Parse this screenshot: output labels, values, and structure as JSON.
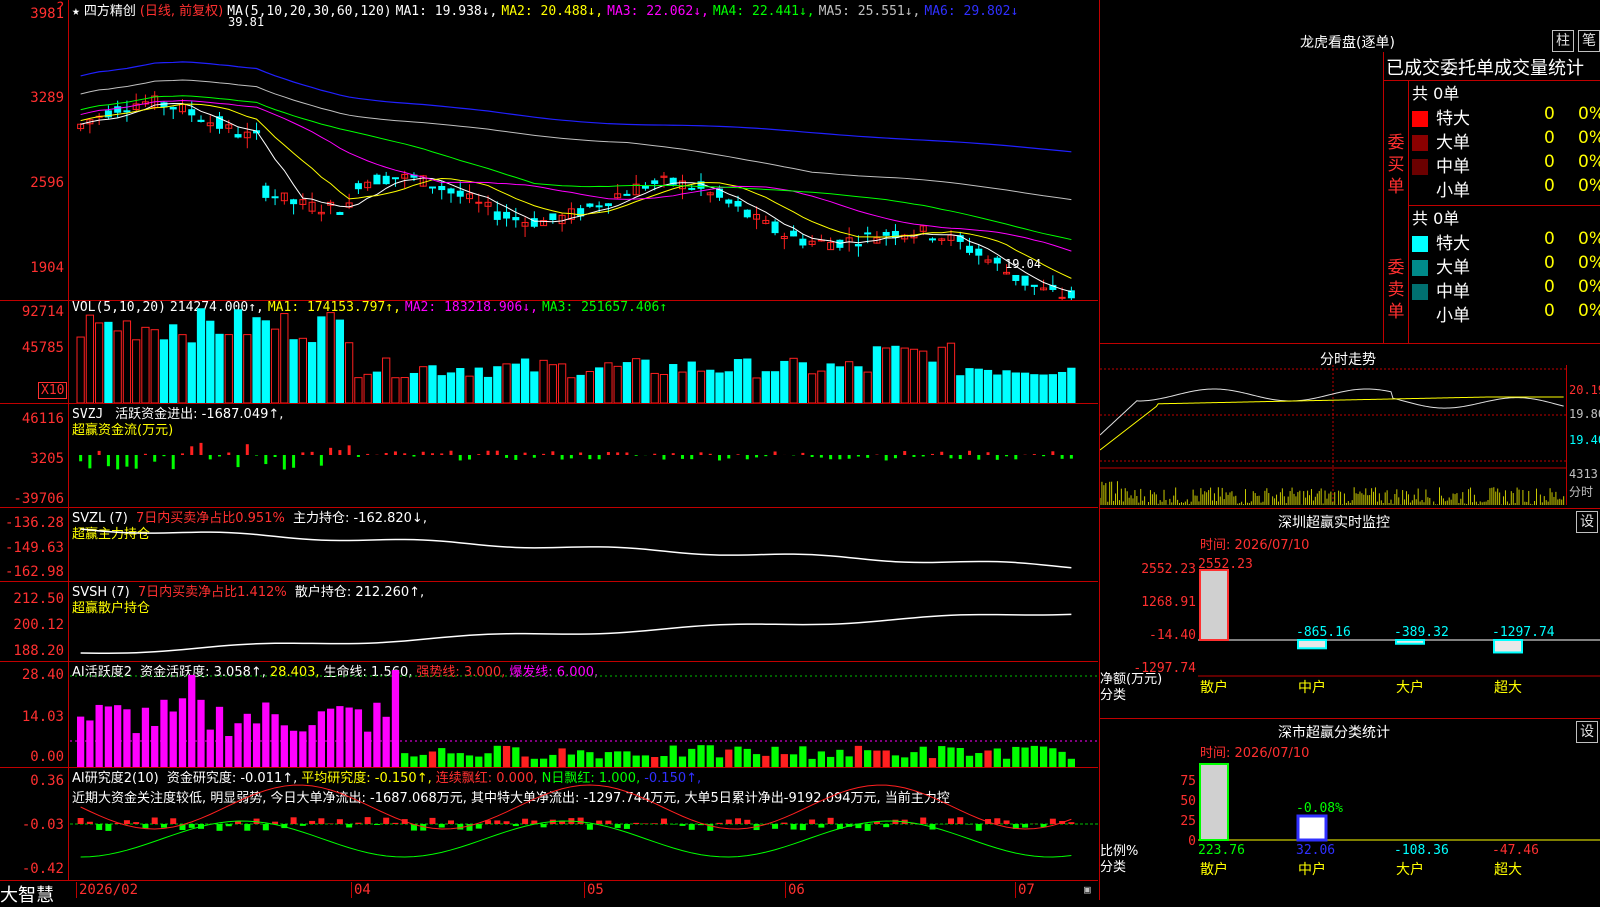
{
  "app": {
    "brand": "大智慧"
  },
  "main_chart": {
    "stock_name": "四方精创",
    "mode": "(日线, 前复权)",
    "ma_label": "MA(5,10,20,30,60,120)",
    "ma1": "MA1: 19.938↓,",
    "ma2": "MA2: 20.488↓,",
    "ma3": "MA3: 22.062↓,",
    "ma4": "MA4: 22.441↓,",
    "ma5": "MA5: 25.551↓,",
    "ma6": "MA6: 29.802↓",
    "y_ticks": [
      "3981",
      "3289",
      "2596",
      "1904"
    ],
    "high_label": "39.81",
    "low_label": "19.04"
  },
  "vol_pane": {
    "title": "VOL(5,10,20)",
    "vol": "214274.000↑,",
    "ma1": "MA1: 174153.797↑,",
    "ma2": "MA2: 183218.906↓,",
    "ma3": "MA3: 251657.406↑",
    "y_ticks": [
      "92714",
      "45785"
    ],
    "unit": "X10"
  },
  "svzj_pane": {
    "title": "SVZJ",
    "value": "活跃资金进出: -1687.049↑,",
    "subtitle": "超赢资金流(万元)",
    "y_ticks": [
      "46116",
      "3205",
      "-39706"
    ]
  },
  "svzl_pane": {
    "title": "SVZL (7)",
    "ratio": "7日内买卖净占比0.951%",
    "value": "主力持仓: -162.820↓,",
    "subtitle": "超赢主力持仓",
    "y_ticks": [
      "-136.28",
      "-149.63",
      "-162.98"
    ]
  },
  "svsh_pane": {
    "title": "SVSH (7)",
    "ratio": "7日内买卖净占比1.412%",
    "value": "散户持仓: 212.260↑,",
    "subtitle": "超赢散户持仓",
    "y_ticks": [
      "212.50",
      "200.12",
      "188.20"
    ]
  },
  "ai_active_pane": {
    "title": "AI活跃度2",
    "v1": "资金活跃度: 3.058↑,",
    "v2": "28.403,",
    "v3": "生命线: 1.560,",
    "v4": "强势线: 3.000,",
    "v5": "爆发线: 6.000,",
    "y_ticks": [
      "28.40",
      "14.03",
      "0.00"
    ]
  },
  "ai_research_pane": {
    "title": "AI研究度2(10)",
    "v1": "资金研究度: -0.011↑,",
    "v2": "平均研究度: -0.150↑,",
    "v3": "连续飘红: 0.000,",
    "v4": "N日飘红: 1.000,",
    "v5": "-0.150↑,",
    "commentary": "近期大资金关注度较低, 明显弱势, 今日大单净流出: -1687.068万元, 其中特大单净流出: -1297.744万元, 大单5日累计净出-9192.094万元, 当前主力控",
    "y_ticks": [
      "0.36",
      "-0.03",
      "-0.42"
    ]
  },
  "x_axis": [
    "2026/02",
    "04",
    "05",
    "06",
    "07"
  ],
  "dragon_tiger": {
    "title": "龙虎看盘(逐单)",
    "btn_bar": "柱",
    "btn_pen": "笔",
    "headline": "已成交委托单成交量统计",
    "buy_label": "委买单",
    "sell_label": "委卖单",
    "buy_total": "共 0单",
    "sell_total": "共 0单",
    "buy_rows": [
      {
        "label": "特大",
        "count": "0",
        "pct": "0%",
        "color": "#ff0000"
      },
      {
        "label": "大单",
        "count": "0",
        "pct": "0%",
        "color": "#8b0000"
      },
      {
        "label": "中单",
        "count": "0",
        "pct": "0%",
        "color": "#6b0000"
      },
      {
        "label": "小单",
        "count": "0",
        "pct": "0%",
        "color": "#000000"
      }
    ],
    "sell_rows": [
      {
        "label": "特大",
        "count": "0",
        "pct": "0%",
        "color": "#00ffff"
      },
      {
        "label": "大单",
        "count": "0",
        "pct": "0%",
        "color": "#008b8b"
      },
      {
        "label": "中单",
        "count": "0",
        "pct": "0%",
        "color": "#007070"
      },
      {
        "label": "小单",
        "count": "0",
        "pct": "0%",
        "color": "#000000"
      }
    ]
  },
  "intraday": {
    "title": "分时走势",
    "price_ticks": [
      "20.19",
      "19.80",
      "19.40"
    ],
    "vol_tick": "4313",
    "vol_label": "分时"
  },
  "sz_monitor": {
    "title": "深圳超赢实时监控",
    "btn": "设",
    "time_label": "时间: 2026/07/10",
    "y_ticks": [
      "2552.23",
      "1268.91",
      "-14.40",
      "-1297.74"
    ],
    "y_unit": "净额(万元)",
    "cat_label": "分类",
    "categories": [
      "散户",
      "中户",
      "大户",
      "超大"
    ],
    "values": [
      2552.23,
      -865.16,
      -389.32,
      -1297.74
    ],
    "value_labels": [
      "2552.23",
      "-865.16",
      "-389.32",
      "-1297.74"
    ]
  },
  "sz_class": {
    "title": "深市超赢分类统计",
    "btn": "设",
    "time_label": "时间: 2026/07/10",
    "y_ticks": [
      "75",
      "50",
      "25",
      "0"
    ],
    "y_unit": "比例%",
    "cat_label": "分类",
    "categories": [
      "散户",
      "中户",
      "大户",
      "超大"
    ],
    "values": [
      223.76,
      32.06,
      -108.36,
      -47.46
    ],
    "value_labels": [
      "223.76",
      "32.06",
      "-108.36",
      "-47.46"
    ],
    "mid_label": "-0.08%"
  }
}
